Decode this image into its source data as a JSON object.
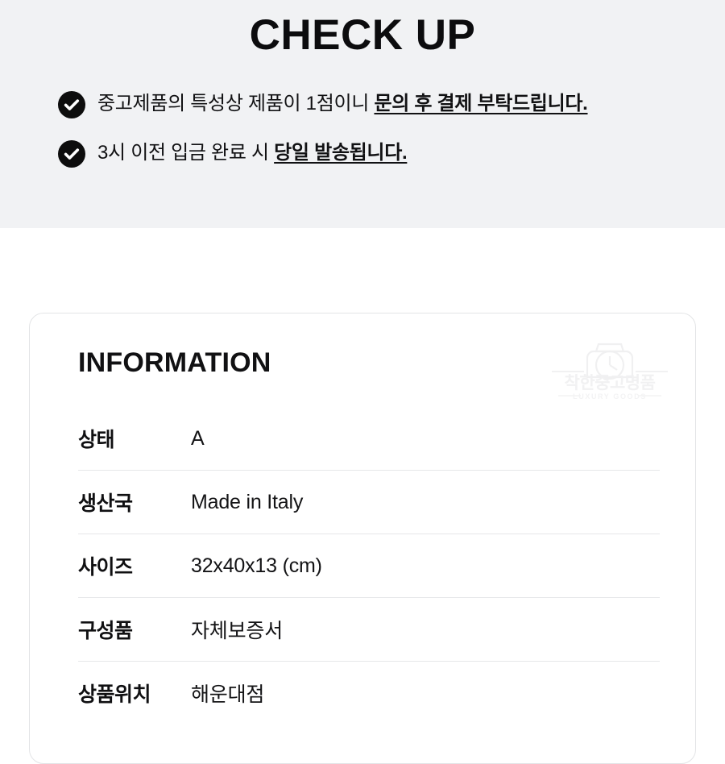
{
  "checkup": {
    "title": "CHECK UP",
    "icon": "check-circle-icon",
    "items": [
      {
        "plain": "중고제품의 특성상 제품이 1점이니 ",
        "emphasis": "문의 후 결제 부탁드립니다."
      },
      {
        "plain": "3시 이전 입금 완료 시 ",
        "emphasis": "당일 발송됩니다."
      }
    ]
  },
  "information": {
    "heading": "INFORMATION",
    "watermark": {
      "icon": "watch-logo-icon",
      "brand_kr": "착한중고명품",
      "brand_en": "LUXURY GOODS"
    },
    "rows": [
      {
        "label": "상태",
        "value": "A"
      },
      {
        "label": "생산국",
        "value": "Made in Italy"
      },
      {
        "label": "사이즈",
        "value": "32x40x13 (cm)"
      },
      {
        "label": "구성품",
        "value": "자체보증서"
      },
      {
        "label": "상품위치",
        "value": "해운대점"
      }
    ]
  },
  "colors": {
    "band_background": "#f1f2f4",
    "page_background": "#ffffff",
    "text_primary": "#111113",
    "card_border": "#e3e4e6",
    "row_divider": "#e6e7e9",
    "icon_fill": "#0d0d0d",
    "watermark": "#f4f4f5"
  }
}
